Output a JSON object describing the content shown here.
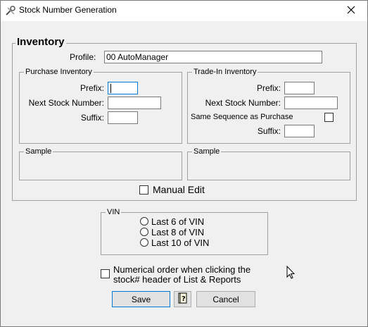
{
  "window": {
    "title": "Stock Number Generation"
  },
  "inventory": {
    "legend": "Inventory",
    "profile_label": "Profile:",
    "profile_value": "00 AutoManager",
    "purchase": {
      "legend": "Purchase Inventory",
      "prefix_label": "Prefix:",
      "prefix_value": "",
      "next_label": "Next Stock Number:",
      "next_value": "",
      "suffix_label": "Suffix:",
      "suffix_value": ""
    },
    "tradein": {
      "legend": "Trade-In Inventory",
      "prefix_label": "Prefix:",
      "prefix_value": "",
      "next_label": "Next Stock Number:",
      "next_value": "",
      "same_seq_label": "Same Sequence as Purchase",
      "same_seq_checked": false,
      "suffix_label": "Suffix:",
      "suffix_value": ""
    },
    "sample_left_legend": "Sample",
    "sample_right_legend": "Sample",
    "manual_edit_label": "Manual Edit",
    "manual_edit_checked": false
  },
  "vin": {
    "legend": "VIN",
    "options": [
      "Last 6 of VIN",
      "Last 8 of VIN",
      "Last 10 of VIN"
    ]
  },
  "numerical_order": {
    "line1": "Numerical order when clicking the",
    "line2": "stock# header of List & Reports",
    "checked": false
  },
  "buttons": {
    "save": "Save",
    "cancel": "Cancel"
  },
  "icons": {
    "app": "tools-icon",
    "close": "close-icon",
    "help": "help-book-icon",
    "cursor": "mouse-pointer-icon"
  },
  "colors": {
    "focus_border": "#0078d7",
    "window_bg": "#f0f0f0"
  }
}
